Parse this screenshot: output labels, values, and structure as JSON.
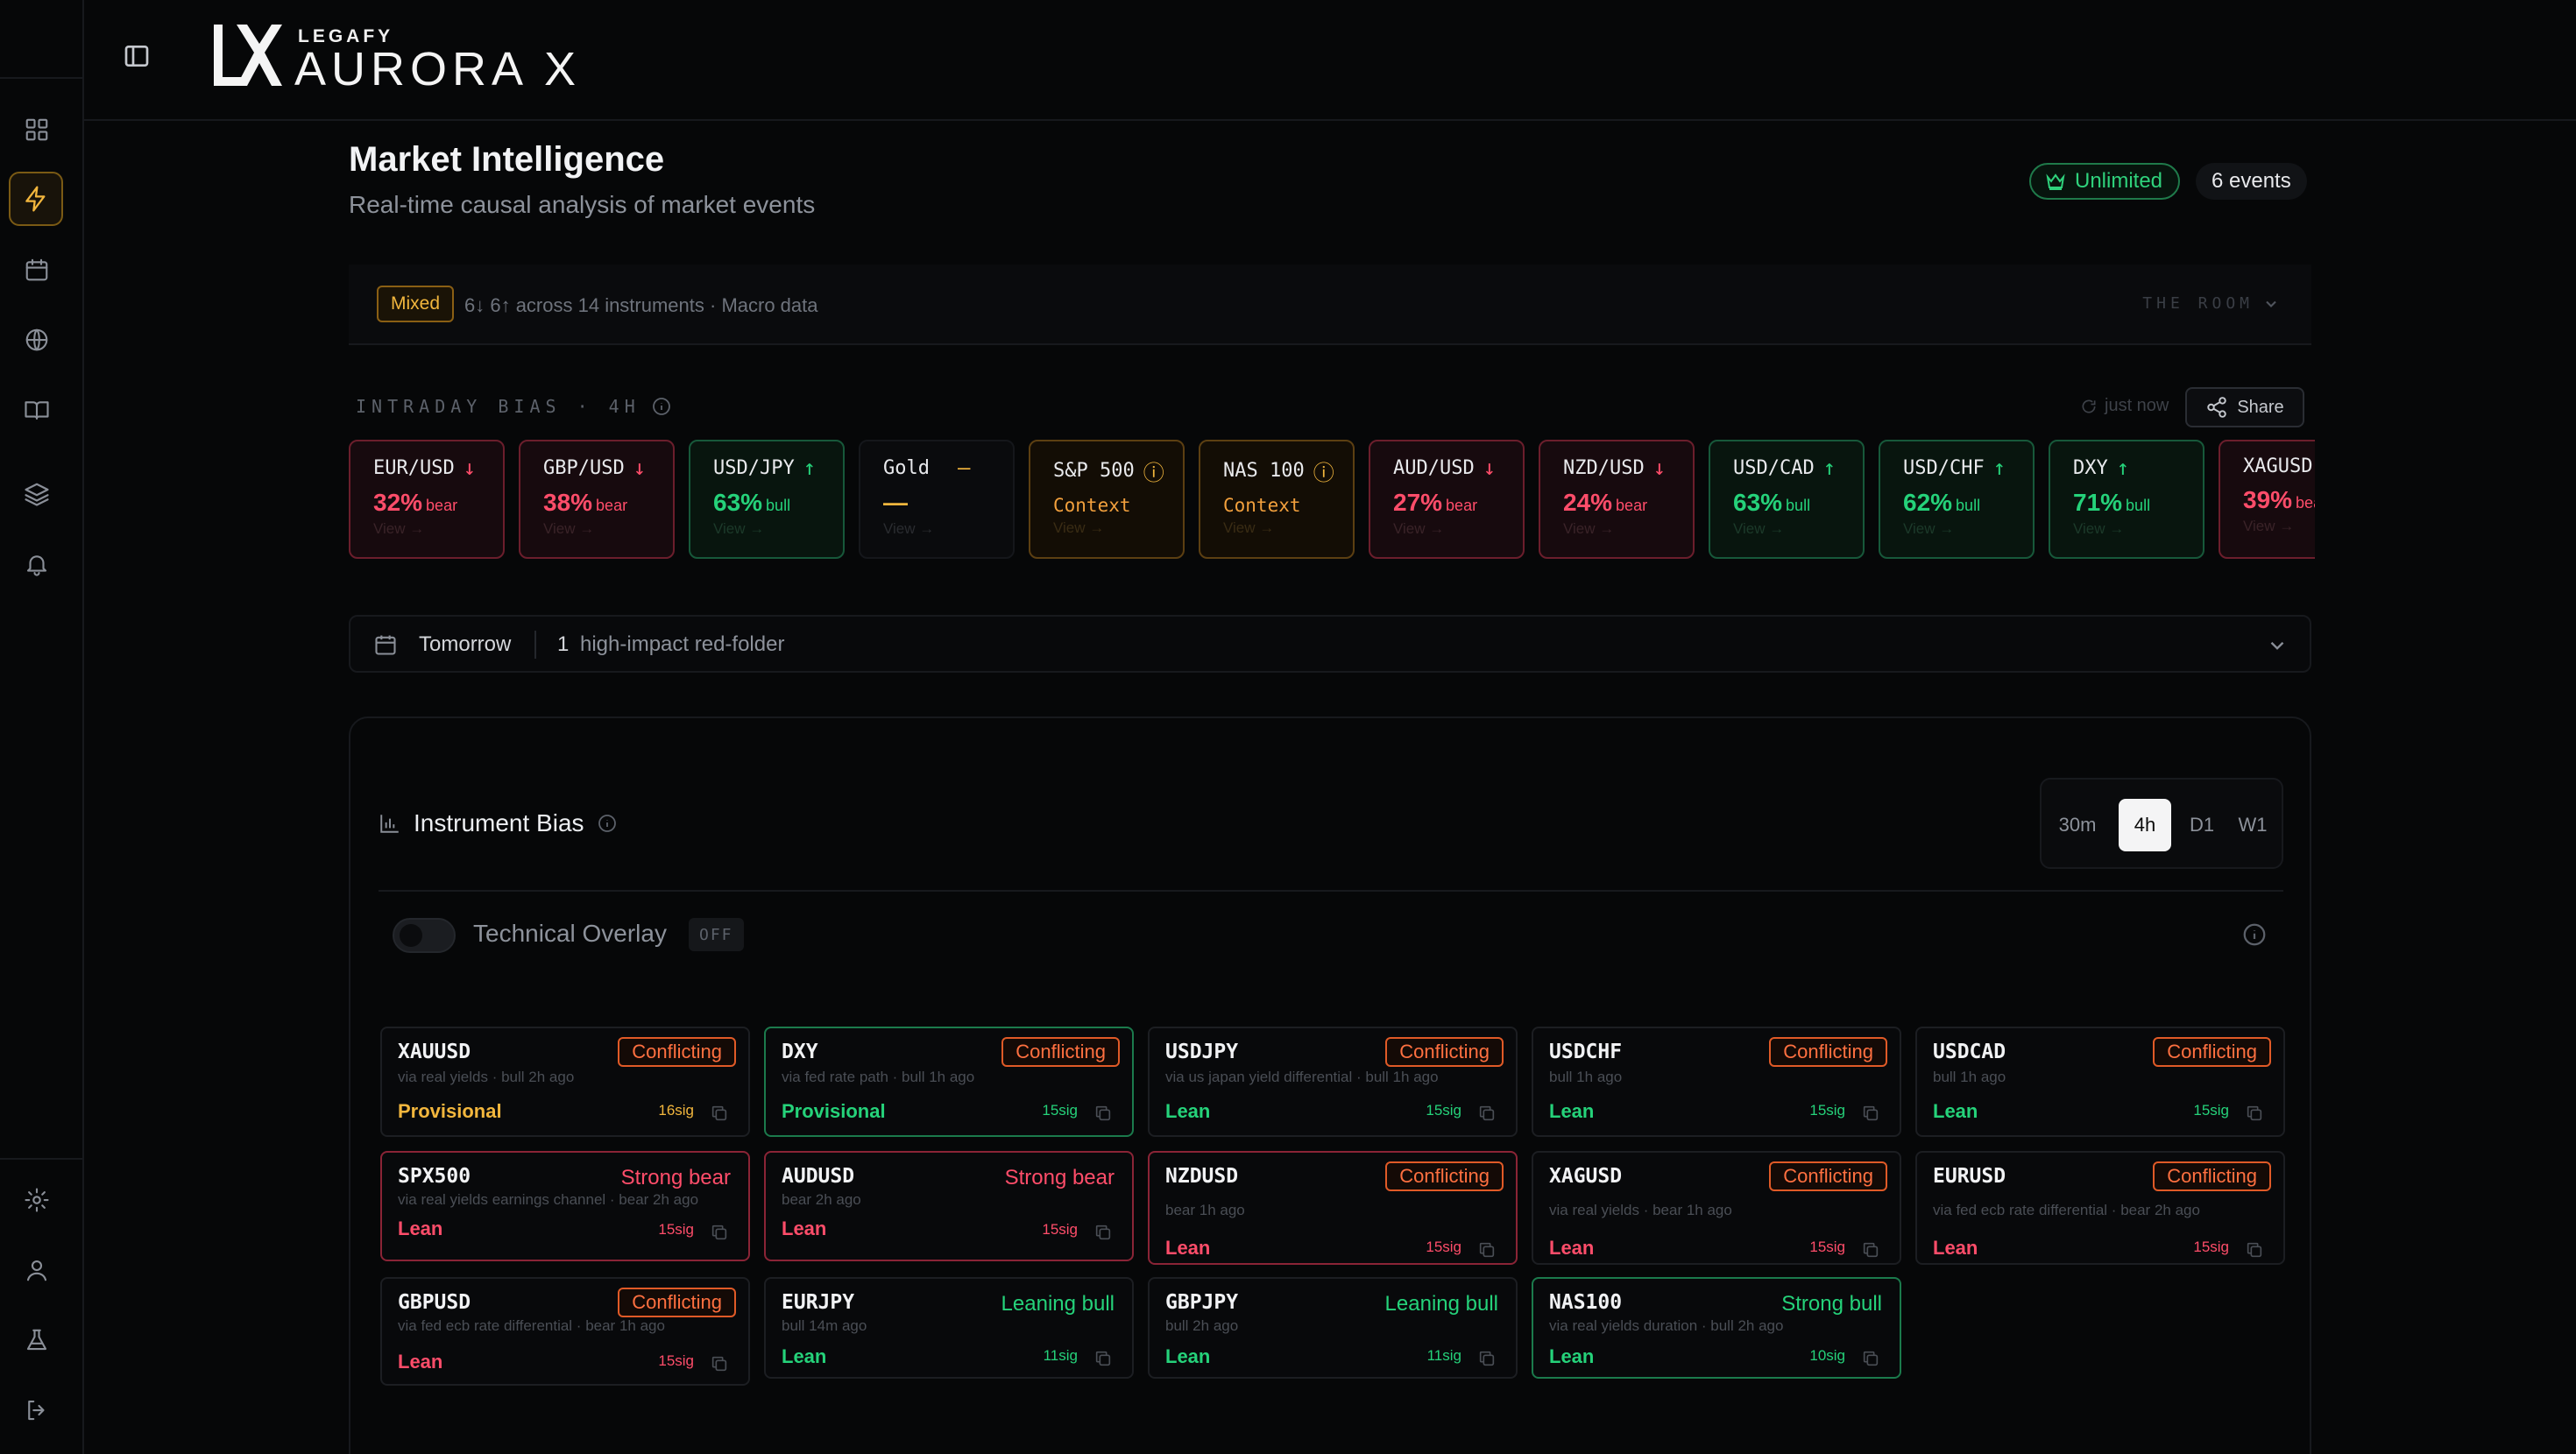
{
  "brand": {
    "small": "LEGAFY",
    "name": "AURORA X"
  },
  "page": {
    "title": "Market Intelligence",
    "subtitle": "Real-time causal analysis of market events"
  },
  "badges": {
    "plan": "Unlimited",
    "events": "6 events"
  },
  "summary": {
    "pill": "Mixed",
    "text": "6↓ 6↑ across 14 instruments · Macro data",
    "room": "THE ROOM"
  },
  "intraday": {
    "label": "INTRADAY BIAS · 4H",
    "refreshed": "just now",
    "share": "Share"
  },
  "bias_cards": [
    {
      "symbol": "EUR/USD",
      "arrow": "↓",
      "value": "32%",
      "dir": "bear",
      "kind": "bear",
      "view": "View →"
    },
    {
      "symbol": "GBP/USD",
      "arrow": "↓",
      "value": "38%",
      "dir": "bear",
      "kind": "bear",
      "view": "View →"
    },
    {
      "symbol": "USD/JPY",
      "arrow": "↑",
      "value": "63%",
      "dir": "bull",
      "kind": "bull",
      "view": "View →"
    },
    {
      "symbol": "Gold",
      "arrow": "—",
      "value": "—",
      "dir": "",
      "kind": "neu",
      "view": "View →"
    },
    {
      "symbol": "S&P 500",
      "arrow": "ⓘ",
      "context": "Context",
      "kind": "ctx",
      "view": "View →"
    },
    {
      "symbol": "NAS 100",
      "arrow": "ⓘ",
      "context": "Context",
      "kind": "ctx",
      "view": "View →"
    },
    {
      "symbol": "AUD/USD",
      "arrow": "↓",
      "value": "27%",
      "dir": "bear",
      "kind": "bear",
      "view": "View →"
    },
    {
      "symbol": "NZD/USD",
      "arrow": "↓",
      "value": "24%",
      "dir": "bear",
      "kind": "bear",
      "view": "View →"
    },
    {
      "symbol": "USD/CAD",
      "arrow": "↑",
      "value": "63%",
      "dir": "bull",
      "kind": "bull",
      "view": "View →"
    },
    {
      "symbol": "USD/CHF",
      "arrow": "↑",
      "value": "62%",
      "dir": "bull",
      "kind": "bull",
      "view": "View →"
    },
    {
      "symbol": "DXY",
      "arrow": "↑",
      "value": "71%",
      "dir": "bull",
      "kind": "bull",
      "view": "View →"
    },
    {
      "symbol": "XAGUSD",
      "arrow": "",
      "value": "39%",
      "dir": "bear",
      "kind": "bear",
      "view": "View →"
    }
  ],
  "tomorrow": {
    "label": "Tomorrow",
    "count": "1",
    "desc": "high-impact  red-folder"
  },
  "instrument_bias": {
    "title": "Instrument Bias",
    "timeframes": [
      "30m",
      "4h",
      "D1",
      "W1"
    ],
    "active_timeframe": "4h",
    "overlay_label": "Technical Overlay",
    "overlay_state": "OFF"
  },
  "instruments": [
    {
      "symbol": "XAUUSD",
      "tag": "Conflicting",
      "tag_style": "box",
      "sub": "via real yields · bull 2h ago",
      "status": "Provisional",
      "status_color": "amber",
      "sig": "16sig",
      "border": ""
    },
    {
      "symbol": "DXY",
      "tag": "Conflicting",
      "tag_style": "box",
      "sub": "via fed rate path · bull 1h ago",
      "status": "Provisional",
      "status_color": "green",
      "sig": "15sig",
      "border": "g"
    },
    {
      "symbol": "USDJPY",
      "tag": "Conflicting",
      "tag_style": "box",
      "sub": "via us japan yield differential · bull 1h ago",
      "status": "Lean",
      "status_color": "green",
      "sig": "15sig",
      "border": ""
    },
    {
      "symbol": "USDCHF",
      "tag": "Conflicting",
      "tag_style": "box",
      "sub": "bull 1h ago",
      "status": "Lean",
      "status_color": "green",
      "sig": "15sig",
      "border": ""
    },
    {
      "symbol": "USDCAD",
      "tag": "Conflicting",
      "tag_style": "box",
      "sub": "bull 1h ago",
      "status": "Lean",
      "status_color": "green",
      "sig": "15sig",
      "border": ""
    },
    {
      "symbol": "SPX500",
      "tag": "Strong bear",
      "tag_style": "red",
      "sub": "via real yields earnings channel · bear 2h ago",
      "status": "Lean",
      "status_color": "red",
      "sig": "15sig",
      "border": "r"
    },
    {
      "symbol": "AUDUSD",
      "tag": "Strong bear",
      "tag_style": "red",
      "sub": "bear 2h ago",
      "status": "Lean",
      "status_color": "red",
      "sig": "15sig",
      "border": "r"
    },
    {
      "symbol": "NZDUSD",
      "tag": "Conflicting",
      "tag_style": "box",
      "sub": "bear 1h ago",
      "status": "Lean",
      "status_color": "red",
      "sig": "15sig",
      "border": "r"
    },
    {
      "symbol": "XAGUSD",
      "tag": "Conflicting",
      "tag_style": "box",
      "sub": "via real yields · bear 1h ago",
      "status": "Lean",
      "status_color": "red",
      "sig": "15sig",
      "border": ""
    },
    {
      "symbol": "EURUSD",
      "tag": "Conflicting",
      "tag_style": "box",
      "sub": "via fed ecb rate differential · bear 2h ago",
      "status": "Lean",
      "status_color": "red",
      "sig": "15sig",
      "border": ""
    },
    {
      "symbol": "GBPUSD",
      "tag": "Conflicting",
      "tag_style": "box",
      "sub": "via fed ecb rate differential · bear 1h ago",
      "status": "Lean",
      "status_color": "red",
      "sig": "15sig",
      "border": ""
    },
    {
      "symbol": "EURJPY",
      "tag": "Leaning bull",
      "tag_style": "green",
      "sub": "bull 14m ago",
      "status": "Lean",
      "status_color": "green",
      "sig": "11sig",
      "border": ""
    },
    {
      "symbol": "GBPJPY",
      "tag": "Leaning bull",
      "tag_style": "green",
      "sub": "bull 2h ago",
      "status": "Lean",
      "status_color": "green",
      "sig": "11sig",
      "border": ""
    },
    {
      "symbol": "NAS100",
      "tag": "Strong bull",
      "tag_style": "green",
      "sub": "via real yields duration · bull 2h ago",
      "status": "Lean",
      "status_color": "green",
      "sig": "10sig",
      "border": "g"
    }
  ],
  "colors": {
    "bear": "#ff4d6a",
    "bull": "#25d27a",
    "amber": "#f2b63d",
    "conflict": "#ff7040"
  }
}
